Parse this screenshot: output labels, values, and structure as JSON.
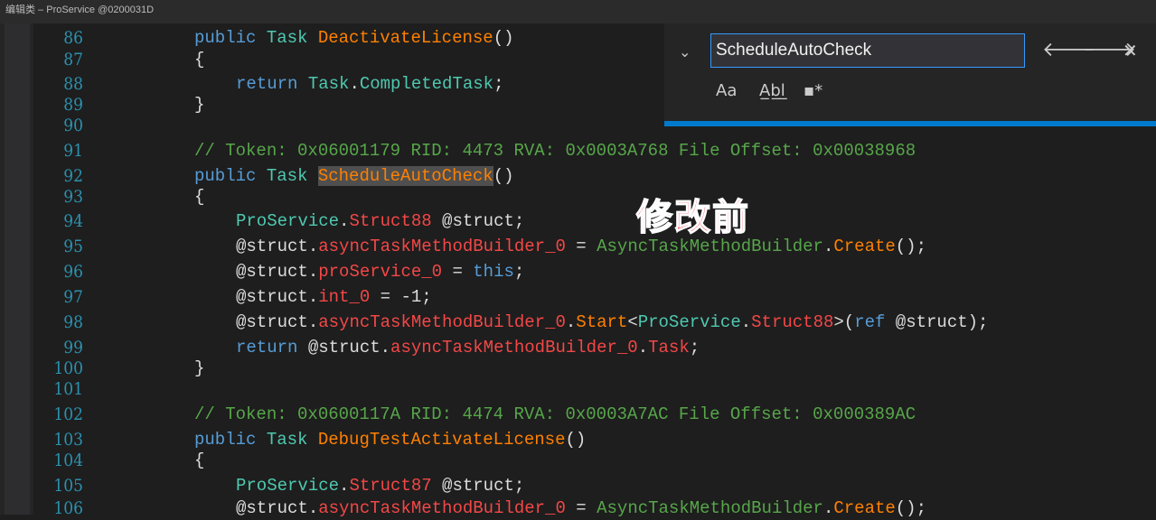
{
  "window": {
    "title": "编辑类 – ProService @0200031D"
  },
  "find": {
    "query": "ScheduleAutoCheck",
    "prev_symbol": "🡐",
    "next_symbol": "🡒",
    "close_symbol": "✕",
    "toggle_symbol": "⌄",
    "match_case_label": "Aa",
    "whole_word_label": "A̲b̲l̲",
    "regex_label": "▪*"
  },
  "annotation": "修改前",
  "code": {
    "line_numbers": [
      "86",
      "87",
      "88",
      "89",
      "90",
      "91",
      "92",
      "93",
      "94",
      "95",
      "96",
      "97",
      "98",
      "99",
      "100",
      "101",
      "102",
      "103",
      "104",
      "105",
      "106"
    ],
    "l86": {
      "kw": "public",
      "ty": "Task",
      "name": "DeactivateLicense",
      "tail": "()"
    },
    "l87": "{",
    "l88": {
      "kw": "return",
      "ty": "Task",
      "dot": ".",
      "prop": "CompletedTask",
      "tail": ";"
    },
    "l89": "}",
    "l91": "// Token: 0x06001179 RID: 4473 RVA: 0x0003A768 File Offset: 0x00038968",
    "l92": {
      "kw": "public",
      "ty": "Task",
      "name": "ScheduleAutoCheck",
      "tail": "()"
    },
    "l93": "{",
    "l94": {
      "ty": "ProService",
      "dot": ".",
      "st": "Struct88",
      "var": " @struct;"
    },
    "l95": {
      "var": "@struct",
      "dot": ".",
      "field": "asyncTaskMethodBuilder_0",
      "eq": " = ",
      "ty": "AsyncTaskMethodBuilder",
      "dot2": ".",
      "call": "Create",
      "tail": "();"
    },
    "l96": {
      "var": "@struct",
      "dot": ".",
      "field": "proService_0",
      "eq": " = ",
      "kw": "this",
      "tail": ";"
    },
    "l97": {
      "var": "@struct",
      "dot": ".",
      "field": "int_0",
      "tail": " = -1;"
    },
    "l98": {
      "var": "@struct",
      "dot": ".",
      "field": "asyncTaskMethodBuilder_0",
      "dot2": ".",
      "call": "Start",
      "lt": "<",
      "ty": "ProService",
      "dot3": ".",
      "st": "Struct88",
      "gt": ">(",
      "kw": "ref",
      "tail": " @struct);"
    },
    "l99": {
      "kw": "return",
      "var": " @struct",
      "dot": ".",
      "field": "asyncTaskMethodBuilder_0",
      "dot2": ".",
      "prop": "Task",
      "tail": ";"
    },
    "l100": "}",
    "l102": "// Token: 0x0600117A RID: 4474 RVA: 0x0003A7AC File Offset: 0x000389AC",
    "l103": {
      "kw": "public",
      "ty": "Task",
      "name": "DebugTestActivateLicense",
      "tail": "()"
    },
    "l104": "{",
    "l105": {
      "ty": "ProService",
      "dot": ".",
      "st": "Struct87",
      "var": " @struct;"
    },
    "l106": {
      "var": "@struct",
      "dot": ".",
      "field": "asyncTaskMethodBuilder_0",
      "eq": " = ",
      "ty": "AsyncTaskMethodBuilder",
      "dot2": ".",
      "call": "Create",
      "tail": "();"
    }
  }
}
